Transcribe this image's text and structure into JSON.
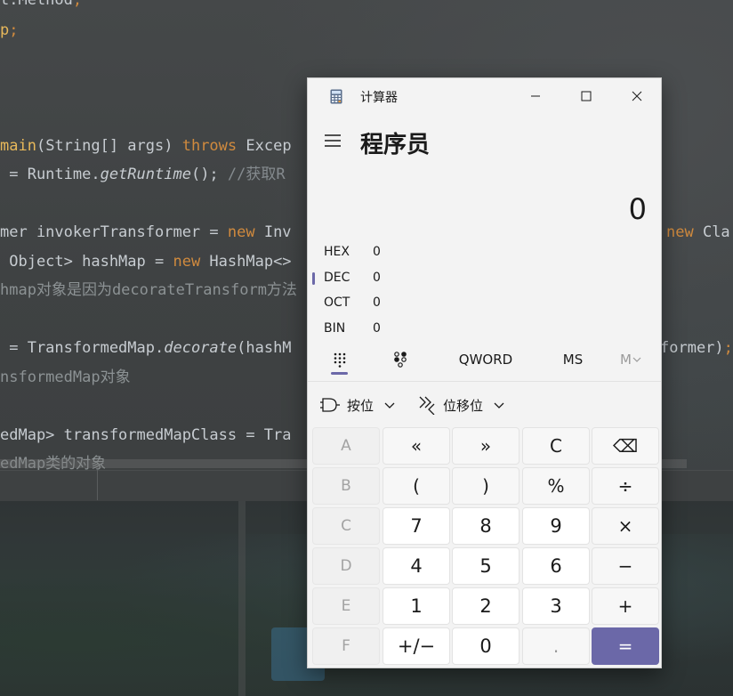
{
  "background_code": {
    "lines": [
      {
        "parts": [
          {
            "t": "t.Method",
            "c": ""
          },
          {
            "t": ",",
            "c": "kw"
          }
        ]
      },
      {
        "parts": [
          {
            "t": "p",
            "c": "fn"
          },
          {
            "t": ";",
            "c": "kw"
          }
        ]
      },
      {
        "parts": [
          {
            "t": "main",
            "c": "fn"
          },
          {
            "t": "(String[] args) ",
            "c": ""
          },
          {
            "t": "throws",
            "c": "kw"
          },
          {
            "t": " Excep",
            "c": ""
          }
        ]
      },
      {
        "parts": [
          {
            "t": " = Runtime.",
            "c": ""
          },
          {
            "t": "getRuntime",
            "c": "it"
          },
          {
            "t": "(); ",
            "c": ""
          },
          {
            "t": "//获取R",
            "c": "cm"
          }
        ]
      },
      {
        "parts": [
          {
            "t": "mer invokerTransformer = ",
            "c": ""
          },
          {
            "t": "new",
            "c": "kw"
          },
          {
            "t": " Inv",
            "c": ""
          }
        ]
      },
      {
        "parts": [
          {
            "t": " Object> hashMap = ",
            "c": ""
          },
          {
            "t": "new",
            "c": "kw"
          },
          {
            "t": " HashMap<>",
            "c": ""
          }
        ]
      },
      {
        "parts": [
          {
            "t": "hmap对象是因为decorateTransform方法",
            "c": "cmz"
          }
        ]
      },
      {
        "parts": [
          {
            "t": " = TransformedMap.",
            "c": ""
          },
          {
            "t": "decorate",
            "c": "it"
          },
          {
            "t": "(hashM",
            "c": ""
          }
        ]
      },
      {
        "parts": [
          {
            "t": "nsformedMap对象",
            "c": "cmz"
          }
        ]
      },
      {
        "parts": [
          {
            "t": "edMap> transformedMapClass = Tra",
            "c": ""
          }
        ]
      },
      {
        "parts": [
          {
            "t": "edMap类的对象",
            "c": "cmz"
          }
        ]
      }
    ],
    "right_fragments": [
      {
        "parts": [
          {
            "t": "new",
            "c": "kw"
          },
          {
            "t": " Cla",
            "c": ""
          }
        ]
      },
      {
        "parts": [
          {
            "t": "former)",
            "c": ""
          },
          {
            "t": ";",
            "c": "kw"
          }
        ]
      }
    ]
  },
  "calculator": {
    "window_title": "计算器",
    "mode_title": "程序员",
    "display_value": "0",
    "radix": [
      {
        "label": "HEX",
        "value": "0",
        "active": false
      },
      {
        "label": "DEC",
        "value": "0",
        "active": true
      },
      {
        "label": "OCT",
        "value": "0",
        "active": false
      },
      {
        "label": "BIN",
        "value": "0",
        "active": false
      }
    ],
    "tabs": {
      "word_size": "QWORD",
      "memory_store": "MS",
      "memory_recall": "M"
    },
    "menus": {
      "bitwise": "按位",
      "bit_shift": "位移位"
    },
    "keys": [
      [
        "A",
        "«",
        "»",
        "C",
        "⌫"
      ],
      [
        "B",
        "(",
        ")",
        "%",
        "÷"
      ],
      [
        "C",
        "7",
        "8",
        "9",
        "×"
      ],
      [
        "D",
        "4",
        "5",
        "6",
        "−"
      ],
      [
        "E",
        "1",
        "2",
        "3",
        "+"
      ],
      [
        "F",
        "+/−",
        "0",
        ".",
        "="
      ]
    ],
    "accent_color": "#6b68a8"
  }
}
